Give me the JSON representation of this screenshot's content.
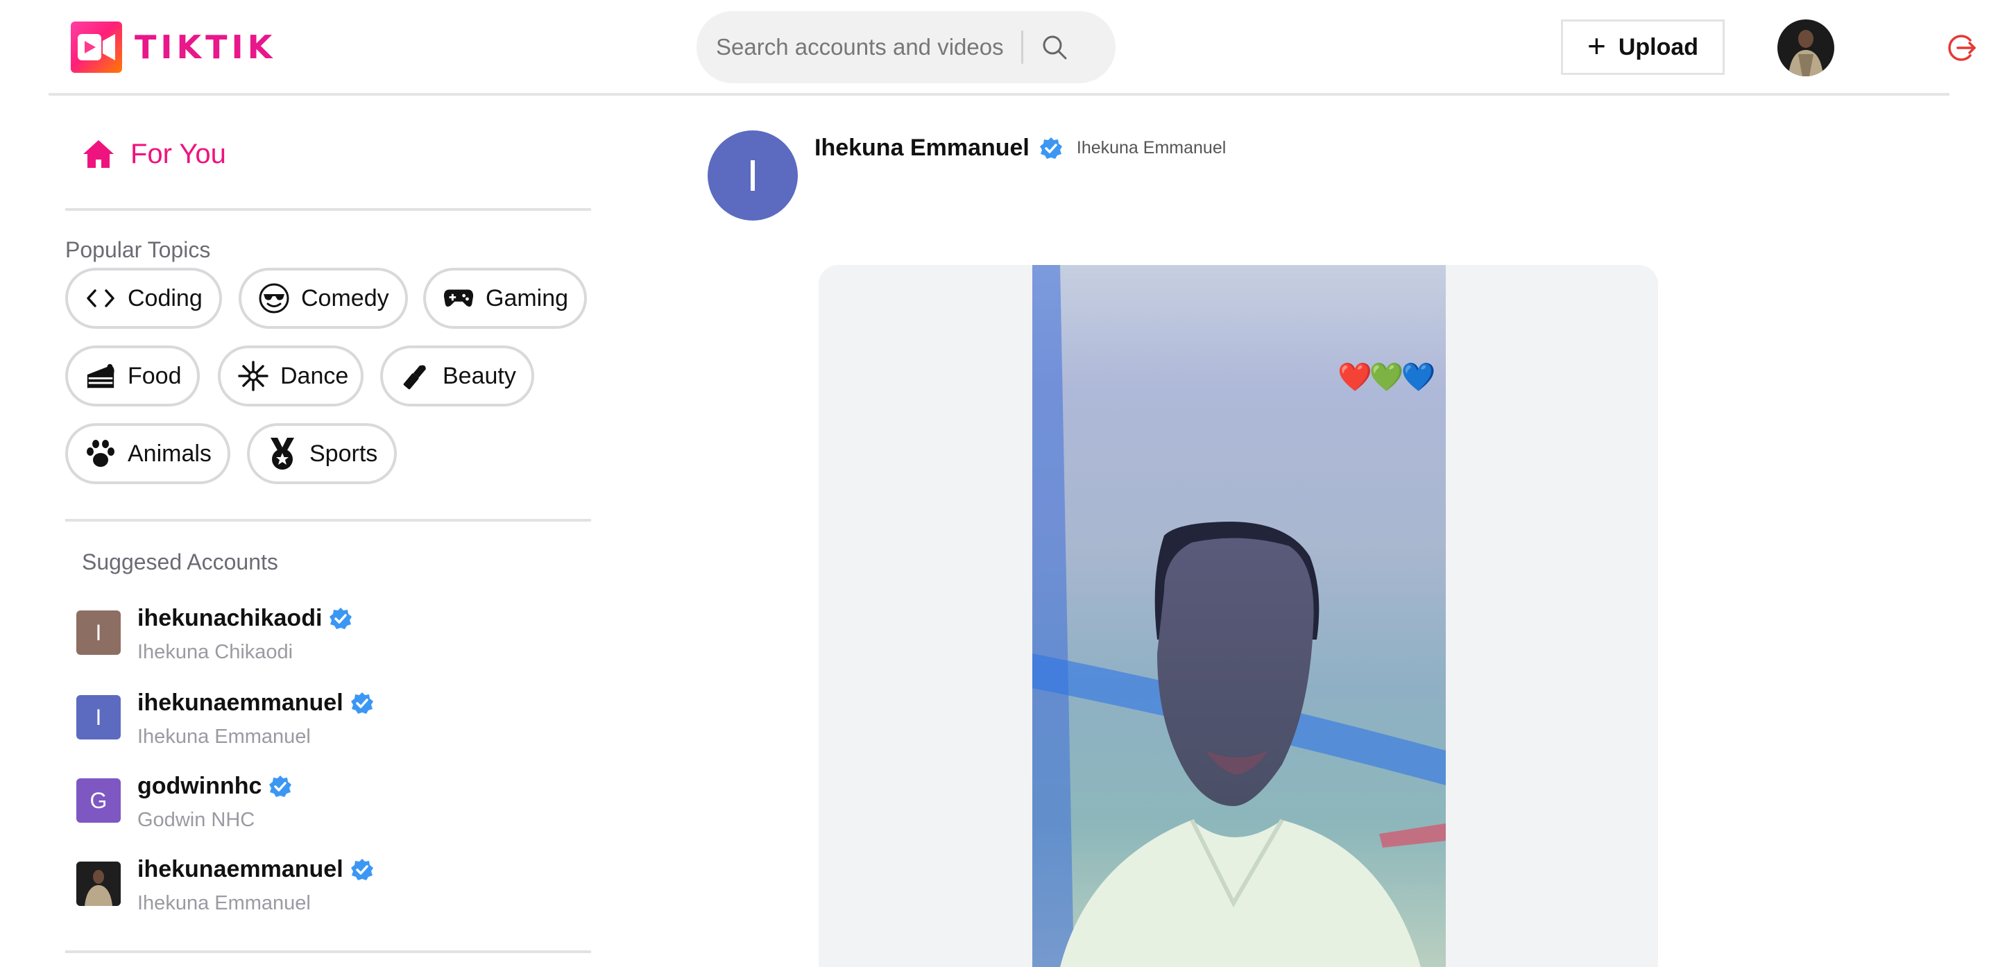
{
  "app": {
    "brand": "TIKTIK",
    "accent_color": "#e8178a",
    "search": {
      "placeholder": "Search accounts and videos",
      "icon": "search-icon"
    },
    "upload": {
      "label": "Upload",
      "icon": "plus-icon"
    },
    "user_avatar": "user-photo-avatar",
    "logout_icon": "logout-icon"
  },
  "sidebar": {
    "for_you": {
      "label": "For You",
      "icon": "home-icon"
    },
    "topics_heading": "Popular Topics",
    "topics": [
      {
        "label": "Coding",
        "icon": "code-icon"
      },
      {
        "label": "Comedy",
        "icon": "cool-face-icon"
      },
      {
        "label": "Gaming",
        "icon": "gamepad-icon"
      },
      {
        "label": "Food",
        "icon": "cake-icon"
      },
      {
        "label": "Dance",
        "icon": "dance-burst-icon"
      },
      {
        "label": "Beauty",
        "icon": "lipstick-icon"
      },
      {
        "label": "Animals",
        "icon": "paw-icon"
      },
      {
        "label": "Sports",
        "icon": "medal-icon"
      }
    ],
    "suggested_heading": "Suggesed Accounts",
    "accounts": [
      {
        "username": "ihekunachikaodi",
        "name": "Ihekuna Chikaodi",
        "initial": "I",
        "color": "#8d6e63"
      },
      {
        "username": "ihekunaemmanuel",
        "name": "Ihekuna Emmanuel",
        "initial": "I",
        "color": "#5c6bc0"
      },
      {
        "username": "godwinnhc",
        "name": "Godwin NHC",
        "initial": "G",
        "color": "#7e57c2"
      },
      {
        "username": "ihekunaemmanuel",
        "name": "Ihekuna Emmanuel",
        "initial": "",
        "color": "#333333"
      }
    ]
  },
  "post": {
    "avatar_initial": "I",
    "avatar_color": "#5c6bc0",
    "display_name": "Ihekuna Emmanuel",
    "username": "Ihekuna Emmanuel",
    "video_caption_overlay": "❤️💚💙",
    "verified_color": "#3b97f3"
  }
}
